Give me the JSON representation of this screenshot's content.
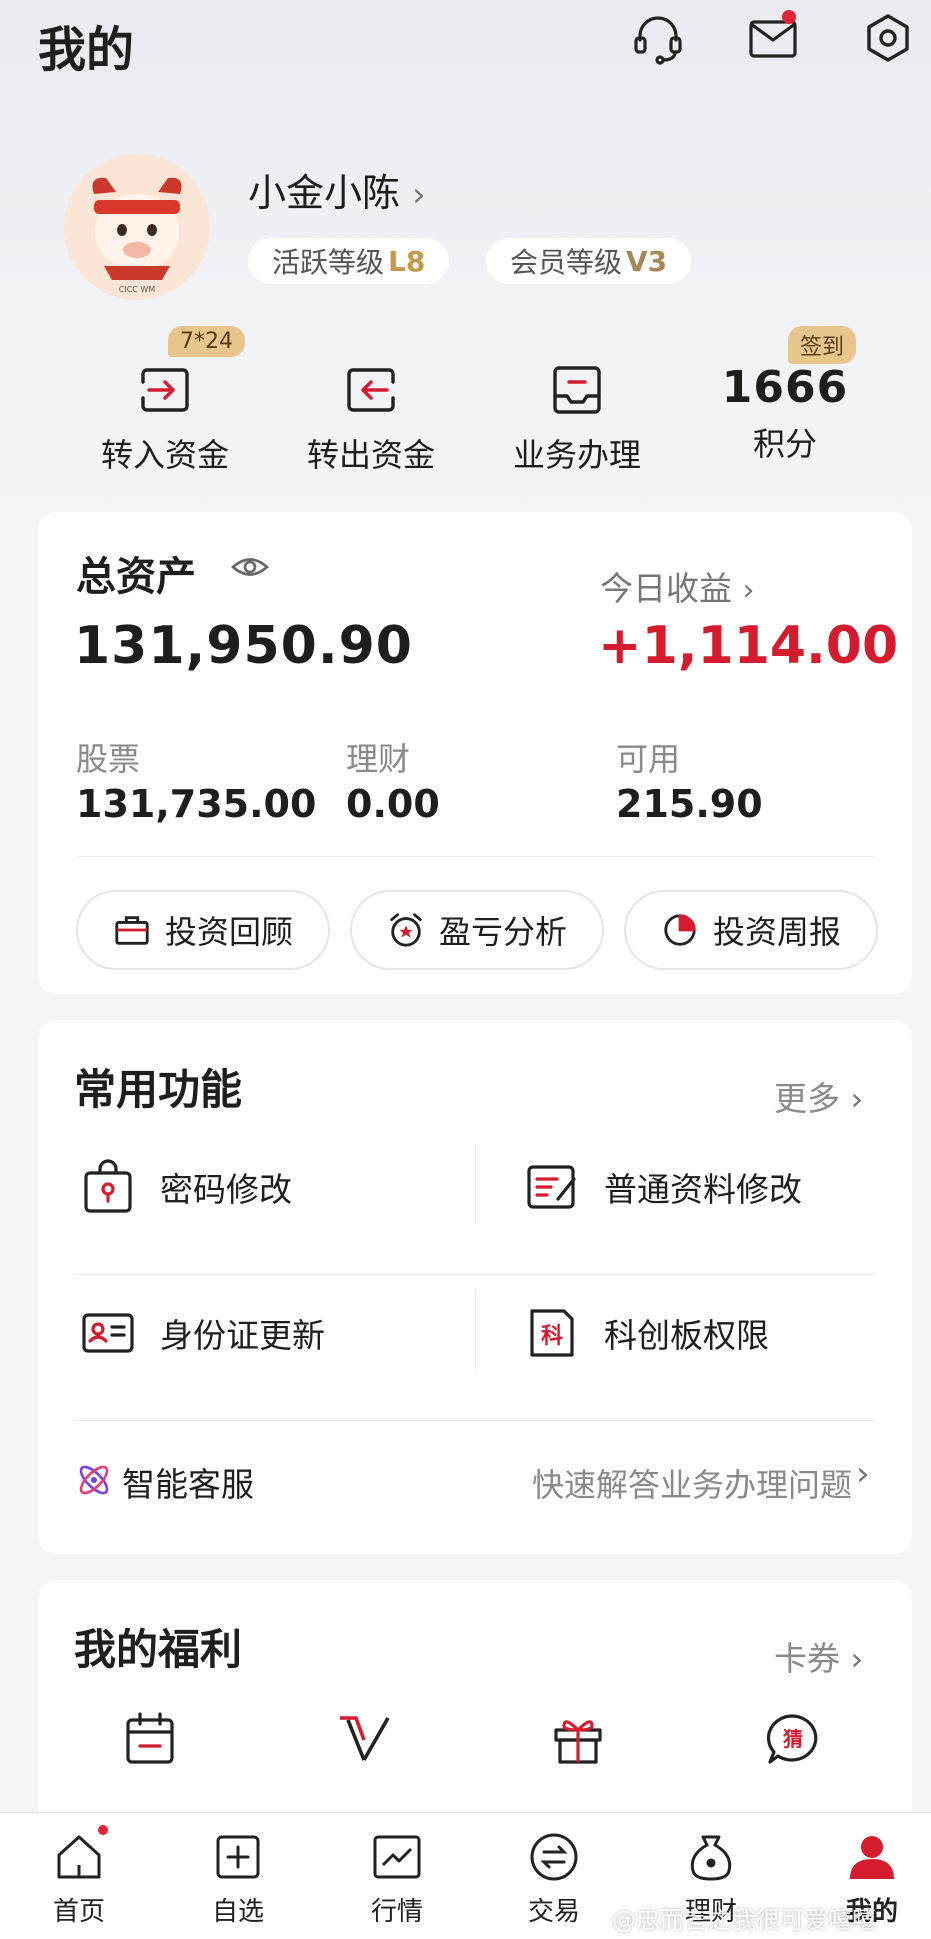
{
  "header": {
    "title": "我的"
  },
  "profile": {
    "name": "小金小陈",
    "activity_label": "活跃等级",
    "activity_level": "L8",
    "member_label": "会员等级",
    "member_level": "V3",
    "avatar_caption": "CICC WM"
  },
  "quick_actions": [
    {
      "label": "转入资金",
      "badge": "7*24"
    },
    {
      "label": "转出资金"
    },
    {
      "label": "业务办理"
    },
    {
      "value": "1666",
      "label": "积分",
      "badge": "签到"
    }
  ],
  "assets": {
    "title": "总资产",
    "total": "131,950.90",
    "today_label": "今日收益",
    "today_value": "+1,114.00",
    "breakdown": [
      {
        "label": "股票",
        "value": "131,735.00"
      },
      {
        "label": "理财",
        "value": "0.00"
      },
      {
        "label": "可用",
        "value": "215.90"
      }
    ],
    "actions": [
      "投资回顾",
      "盈亏分析",
      "投资周报"
    ]
  },
  "common": {
    "title": "常用功能",
    "more": "更多",
    "items": [
      "密码修改",
      "普通资料修改",
      "身份证更新",
      "科创板权限"
    ],
    "ke_glyph": "科",
    "service_label": "智能客服",
    "service_desc": "快速解答业务办理问题"
  },
  "welfare": {
    "title": "我的福利",
    "link": "卡券",
    "guess_glyph": "猜"
  },
  "nav": [
    {
      "label": "首页"
    },
    {
      "label": "自选"
    },
    {
      "label": "行情"
    },
    {
      "label": "交易"
    },
    {
      "label": "理财"
    },
    {
      "label": "我的"
    }
  ],
  "watermark": "@忠而言之我很可爱嘻嘻",
  "colors": {
    "accent_red": "#d51c2e",
    "gold": "#e8c58d",
    "dot": "#e02437"
  }
}
